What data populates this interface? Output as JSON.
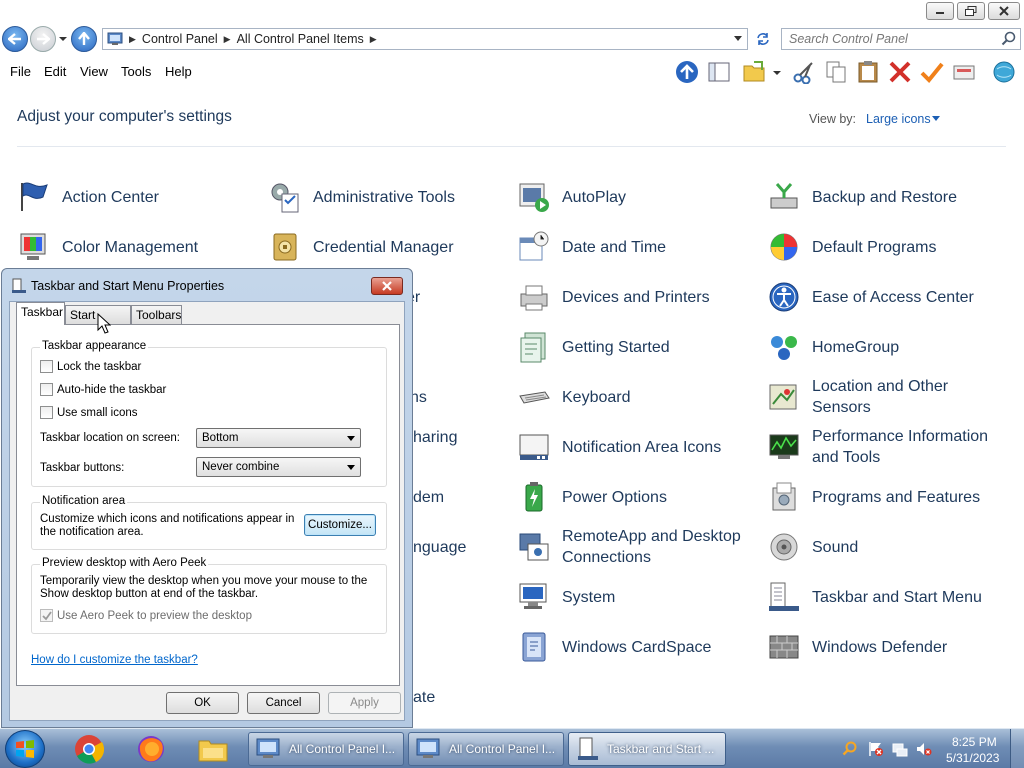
{
  "window": {
    "breadcrumbs": [
      "Control Panel",
      "All Control Panel Items"
    ],
    "search_placeholder": "Search Control Panel"
  },
  "menu": [
    "File",
    "Edit",
    "View",
    "Tools",
    "Help"
  ],
  "content": {
    "title": "Adjust your computer's settings",
    "view_by_label": "View by:",
    "view_by_value": "Large icons",
    "items": [
      "Action Center",
      "Administrative Tools",
      "AutoPlay",
      "Backup and Restore",
      "Color Management",
      "Credential Manager",
      "Date and Time",
      "Default Programs",
      "Devices and Printers",
      "Ease of Access Center",
      "Getting Started",
      "HomeGroup",
      "Keyboard",
      "Location and Other Sensors",
      "Notification Area Icons",
      "Performance Information and Tools",
      "Power Options",
      "Programs and Features",
      "RemoteApp and Desktop Connections",
      "Sound",
      "System",
      "Taskbar and Start Menu",
      "Windows CardSpace",
      "Windows Defender"
    ],
    "partial_items": [
      "er",
      "ns",
      "haring",
      "dem",
      "nguage",
      "ate"
    ]
  },
  "dialog": {
    "title": "Taskbar and Start Menu Properties",
    "tabs": [
      "Taskbar",
      "Start Menu",
      "Toolbars"
    ],
    "appearance": {
      "title": "Taskbar appearance",
      "lock": "Lock the taskbar",
      "autohide": "Auto-hide the taskbar",
      "small_icons": "Use small icons",
      "location_label": "Taskbar location on screen:",
      "location_value": "Bottom",
      "buttons_label": "Taskbar buttons:",
      "buttons_value": "Never combine"
    },
    "notification": {
      "title": "Notification area",
      "text": "Customize which icons and notifications appear in the notification area.",
      "customize": "Customize..."
    },
    "peek": {
      "title": "Preview desktop with Aero Peek",
      "text": "Temporarily view the desktop when you move your mouse to the Show desktop button at end of the taskbar.",
      "checkbox": "Use Aero Peek to preview the desktop"
    },
    "help_link": "How do I customize the taskbar?",
    "ok": "OK",
    "cancel": "Cancel",
    "apply": "Apply"
  },
  "taskbar": {
    "tasks": [
      "All Control Panel I...",
      "All Control Panel I...",
      "Taskbar and Start ..."
    ],
    "time": "8:25 PM",
    "date": "5/31/2023"
  }
}
